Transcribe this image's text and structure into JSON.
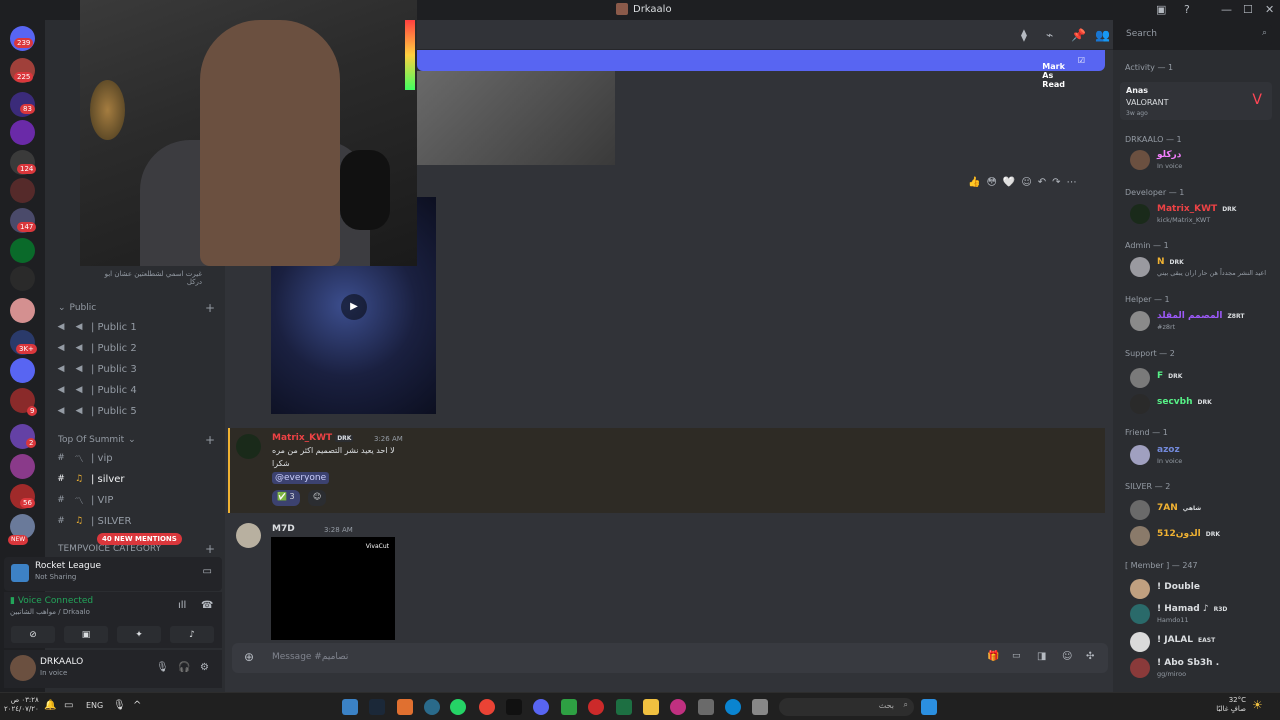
{
  "window": {
    "title": "Drkaalo"
  },
  "rail_badges": [
    "239",
    "225",
    "83",
    "124",
    "147",
    "3K+",
    "9",
    "2",
    "56",
    "NEW"
  ],
  "sidebar": {
    "voice_status_line": "غيرت اسمي لشطلعتين عشان ابو دركل",
    "sections": [
      {
        "label": "Public",
        "channels": [
          "| Public 1",
          "| Public 2",
          "| Public 3",
          "| Public 4",
          "| Public 5"
        ]
      },
      {
        "label": "Top Of Summit",
        "channels": [
          "| vip",
          "| silver",
          "| VIP",
          "| SILVER"
        ]
      },
      {
        "label": "TEMPVOICE CATEGORY"
      }
    ],
    "new_mentions": "40 NEW MENTIONS",
    "activity": {
      "name": "Rocket League",
      "status": "Not Sharing"
    },
    "voice": {
      "status": "Voice Connected",
      "channel": "مواهب الشاتبين / Drkaalo"
    },
    "user": {
      "name": "DRKAALO",
      "status": "In voice"
    }
  },
  "header": {
    "search_placeholder": "Search"
  },
  "main": {
    "mark_as_read": "Mark As Read",
    "messages": [
      {
        "author": "Matrix_KWT",
        "tag": "DRK",
        "time": "3:26 AM",
        "lines": [
          "لا احد يعيد نشر التصميم اكثر من مره",
          "شكرا"
        ],
        "mention": "@everyone",
        "reaction_count": "3"
      },
      {
        "author": "M7D",
        "time": "3:28 AM",
        "watermark": "VivaCut"
      }
    ],
    "composer_placeholder": "Message #تصاميم"
  },
  "members": {
    "activity_title": "Activity — 1",
    "activity": {
      "user": "Anas",
      "game": "VALORANT",
      "ago": "3w ago"
    },
    "groups": [
      {
        "label": "DRKAALO — 1",
        "members": [
          {
            "name": "دركلو",
            "sub": "In voice",
            "color": "#f47fff"
          }
        ]
      },
      {
        "label": "Developer — 1",
        "members": [
          {
            "name": "Matrix_KWT",
            "tag": "DRK",
            "sub": "kick/Matrix_KWT",
            "color": "#ed4245"
          }
        ]
      },
      {
        "label": "Admin — 1",
        "members": [
          {
            "name": "N",
            "tag": "DRK",
            "sub": "اعيد النشر مجدداً هن حار اران يبقى بيني",
            "color": "#f0b232"
          }
        ]
      },
      {
        "label": "Helper — 1",
        "members": [
          {
            "name": "المصمم المقلد",
            "tag": "Z8RT",
            "sub": "#z8rt",
            "color": "#9b59f6"
          }
        ]
      },
      {
        "label": "Support — 2",
        "members": [
          {
            "name": "F",
            "tag": "DRK",
            "sub": "",
            "color": "#57f287"
          },
          {
            "name": "secvbh",
            "tag": "DRK",
            "sub": "",
            "color": "#57f287"
          }
        ]
      },
      {
        "label": "Friend — 1",
        "members": [
          {
            "name": "azoz",
            "sub": "In voice",
            "color": "#7289da"
          }
        ]
      },
      {
        "label": "SILVER — 2",
        "members": [
          {
            "name": "7AN",
            "tag": "شاهي",
            "sub": "",
            "color": "#f0b232"
          },
          {
            "name": "الدون512",
            "tag": "DRK",
            "sub": "",
            "color": "#f0b232"
          }
        ]
      },
      {
        "label": "[ Member ] — 247",
        "members": [
          {
            "name": "! Double",
            "sub": "",
            "color": "#dbdee1"
          },
          {
            "name": "! Hamad ♪",
            "tag": "R3D",
            "sub": "Hamdo11",
            "color": "#dbdee1"
          },
          {
            "name": "! JALAL",
            "tag": "EAST",
            "sub": "",
            "color": "#dbdee1"
          },
          {
            "name": "! Abo Sb3h .",
            "sub": "gg/miroo",
            "color": "#dbdee1"
          }
        ]
      }
    ]
  },
  "taskbar": {
    "search_placeholder": "بحث",
    "lang": "ENG",
    "weather_temp": "32°C",
    "weather_desc": "صافٍ غالبًا",
    "time": "٠٣:٢٨ ص",
    "date": "٢٠٢٤/٠٧/٢٠"
  }
}
